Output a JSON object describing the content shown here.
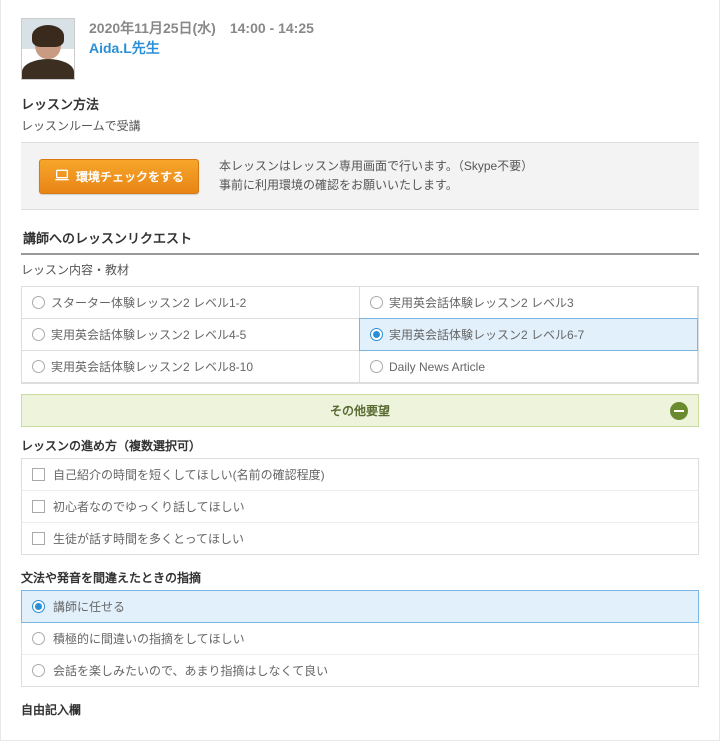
{
  "header": {
    "date_line": "2020年11月25日(水)　14:00 - 14:25",
    "teacher": "Aida.L先生"
  },
  "method": {
    "title": "レッスン方法",
    "value": "レッスンルームで受講",
    "env_button": "環境チェックをする",
    "notice_line1": "本レッスンはレッスン専用画面で行います。（Skype不要）",
    "notice_line2": "事前に利用環境の確認をお願いいたします。"
  },
  "request": {
    "heading": "講師へのレッスンリクエスト",
    "content_label": "レッスン内容・教材",
    "options": [
      {
        "label": "スターター体験レッスン2 レベル1-2",
        "selected": false
      },
      {
        "label": "実用英会話体験レッスン2 レベル3",
        "selected": false
      },
      {
        "label": "実用英会話体験レッスン2 レベル4-5",
        "selected": false
      },
      {
        "label": "実用英会話体験レッスン2 レベル6-7",
        "selected": true
      },
      {
        "label": "実用英会話体験レッスン2 レベル8-10",
        "selected": false
      },
      {
        "label": "Daily News Article",
        "selected": false
      }
    ]
  },
  "other_request": {
    "bar_label": "その他要望"
  },
  "progress": {
    "label": "レッスンの進め方（複数選択可）",
    "items": [
      "自己紹介の時間を短くしてほしい(名前の確認程度)",
      "初心者なのでゆっくり話してほしい",
      "生徒が話す時間を多くとってほしい"
    ]
  },
  "correction": {
    "label": "文法や発音を間違えたときの指摘",
    "items": [
      {
        "label": "講師に任せる",
        "selected": true
      },
      {
        "label": "積極的に間違いの指摘をしてほしい",
        "selected": false
      },
      {
        "label": "会話を楽しみたいので、あまり指摘はしなくて良い",
        "selected": false
      }
    ]
  },
  "freeform": {
    "label": "自由記入欄"
  }
}
